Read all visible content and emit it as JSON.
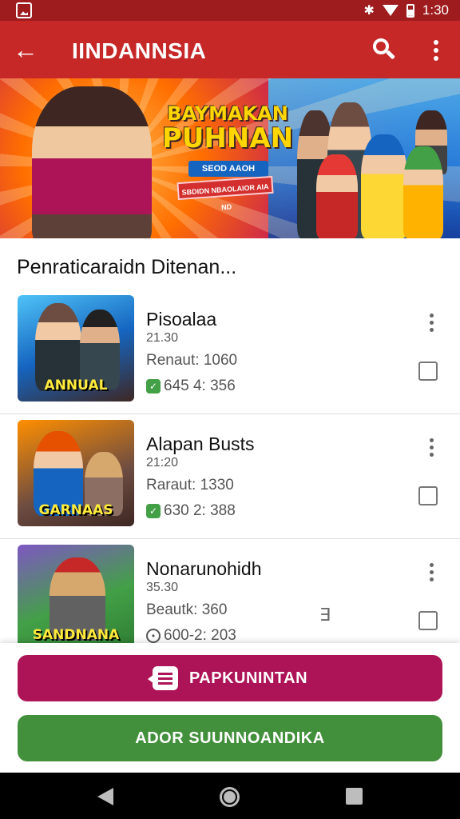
{
  "status_bar": {
    "time": "1:30",
    "icons": [
      "gallery-icon",
      "bluetooth-icon",
      "wifi-icon",
      "battery-icon"
    ]
  },
  "app_bar": {
    "title": "IINDANNSIA",
    "icons": [
      "back-arrow-icon",
      "search-icon",
      "more-vert-icon"
    ],
    "color": "#c62828"
  },
  "banner": {
    "title_line1": "BAYMAKAN",
    "title_line2": "PUHNAN",
    "subtitle": "SEOD AAOH",
    "tagline": "SBDIDN NBAOLAIOR AIA ND"
  },
  "section": {
    "title": "Penraticaraidn Ditenan..."
  },
  "apps": [
    {
      "name": "Pisoalaa",
      "version": "21.30",
      "meta": "Renaut: 1060",
      "stat": "645 4: 356",
      "stat_icon": "green-badge-icon",
      "thumb_label": "ANNUAL"
    },
    {
      "name": "Alapan Busts",
      "version": "21:20",
      "meta": "Raraut: 1330",
      "stat": "630 2: 388",
      "stat_icon": "green-badge-icon",
      "thumb_label": "GARNAAS"
    },
    {
      "name": "Nonarunohidh",
      "version": "35.30",
      "meta": "Beautk: 360",
      "stat": "600-2: 203",
      "stat_icon": "clock-icon",
      "thumb_label": "SANDNANA"
    }
  ],
  "actions": {
    "primary_label": "PAPKUNINTAN",
    "secondary_label": "ADOR SUUNNOANDIKA",
    "primary_color": "#ad1457",
    "secondary_color": "#43903c"
  },
  "nav_bar": {
    "icons": [
      "nav-back-icon",
      "nav-home-icon",
      "nav-recents-icon"
    ]
  }
}
